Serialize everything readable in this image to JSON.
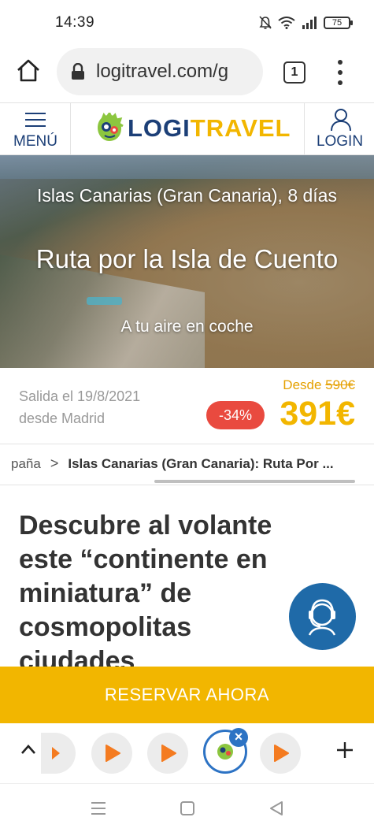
{
  "status_bar": {
    "time": "14:39",
    "battery": "75",
    "icons": [
      "bell-off-icon",
      "wifi-icon",
      "signal-icon",
      "battery-icon"
    ]
  },
  "browser": {
    "url": "logitravel.com/g",
    "tab_count": "1"
  },
  "site_header": {
    "menu_label": "MENÚ",
    "logo_logi": "LOGI",
    "logo_travel": "TRAVEL",
    "login_label": "LOGIN",
    "colors": {
      "brand_blue": "#1c3f77",
      "brand_yellow": "#f2b600"
    }
  },
  "hero": {
    "region": "Islas Canarias (Gran Canaria), 8 días",
    "title": "Ruta por la Isla de Cuento",
    "subtitle": "A tu aire en coche"
  },
  "price_bar": {
    "departure_date": "Salida el 19/8/2021",
    "departure_city": "desde Madrid",
    "from_label": "Desde",
    "old_price": "590€",
    "discount": "-34%",
    "price": "391€",
    "colors": {
      "discount_red": "#e94a3f",
      "price_yellow": "#f2b600"
    }
  },
  "breadcrumb": {
    "previous": "paña",
    "separator": ">",
    "current": "Islas Canarias (Gran Canaria): Ruta Por ..."
  },
  "content": {
    "heading": "Descubre al volante este “continente en miniatura” de cosmopolitas ciudades"
  },
  "cta": {
    "label": "RESERVAR AHORA"
  },
  "bubbles": {
    "close_label": "×"
  }
}
